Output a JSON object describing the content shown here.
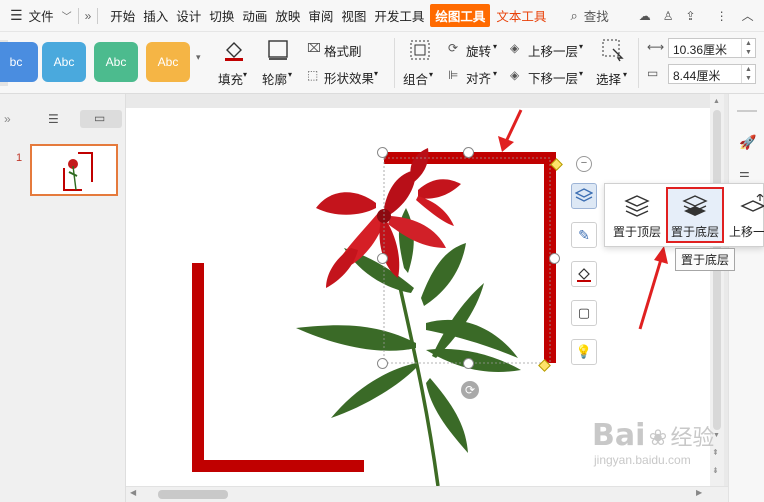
{
  "menubar": {
    "file_label": "文件",
    "tabs": [
      "开始",
      "插入",
      "设计",
      "切换",
      "动画",
      "放映",
      "审阅",
      "视图",
      "开发工具"
    ],
    "active_tab": "绘图工具",
    "text_tools_tab": "文本工具",
    "search_label": "查找"
  },
  "ribbon": {
    "style_presets": [
      "bc",
      "Abc",
      "Abc",
      "Abc"
    ],
    "style_colors": [
      "#4a8de0",
      "#4aa9dd",
      "#4cbb8e",
      "#f5b545"
    ],
    "fill_label": "填充",
    "outline_label": "轮廓",
    "format_brush_label": "格式刷",
    "shape_effects_label": "形状效果",
    "group_label": "组合",
    "rotate_label": "旋转",
    "align_label": "对齐",
    "bring_forward_label": "上移一层",
    "send_backward_label": "下移一层",
    "select_label": "选择",
    "width_value": "10.36厘米",
    "height_value": "8.44厘米"
  },
  "leftpane": {
    "slide_number": "1"
  },
  "arrange_popup": {
    "items": [
      "置于顶层",
      "置于底层",
      "上移一层"
    ],
    "highlighted": "置于底层",
    "tooltip": "置于底层"
  },
  "watermark": {
    "brand": "Bai",
    "brand_cn": "经验",
    "url": "jingyan.baidu.com"
  },
  "colors": {
    "accent": "#ff6a00",
    "frame": "#c00000",
    "highlight": "#e02020"
  }
}
